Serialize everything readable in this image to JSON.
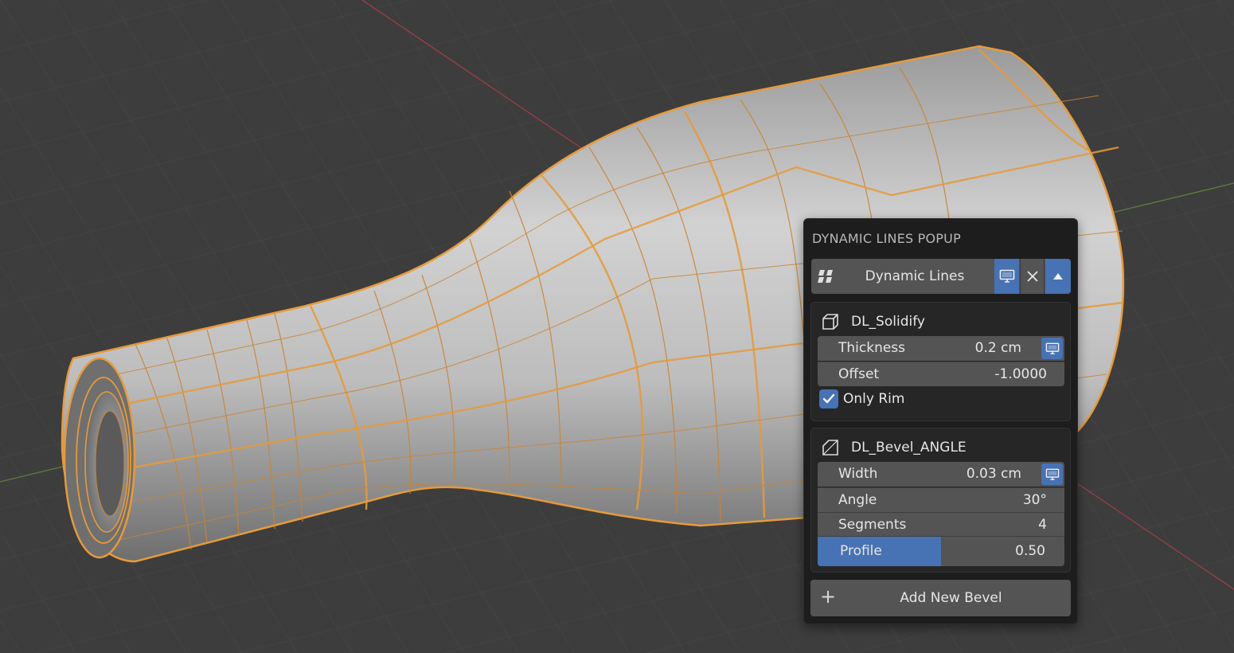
{
  "viewport": {
    "object_color": "#c9c9c9",
    "wire_color": "#e69a3c",
    "background_color": "#3d3d3d"
  },
  "popup": {
    "title": "DYNAMIC LINES POPUP",
    "header": {
      "label": "Dynamic Lines",
      "grip_icon": "grip-icon",
      "monitor_icon": "monitor-icon",
      "close_icon": "close-icon",
      "collapse_icon": "triangle-up-icon"
    },
    "solidify": {
      "name": "DL_Solidify",
      "icon": "solidify-cube-icon",
      "thickness_label": "Thickness",
      "thickness_value": "0.2 cm",
      "offset_label": "Offset",
      "offset_value": "-1.0000",
      "only_rim_label": "Only Rim",
      "only_rim_checked": true
    },
    "bevel": {
      "name": "DL_Bevel_ANGLE",
      "icon": "bevel-icon",
      "width_label": "Width",
      "width_value": "0.03 cm",
      "angle_label": "Angle",
      "angle_value": "30°",
      "segments_label": "Segments",
      "segments_value": "4",
      "profile_label": "Profile",
      "profile_value": "0.50",
      "profile_fraction": 0.5
    },
    "add_button": {
      "icon": "plus-icon",
      "label": "Add New Bevel"
    },
    "accent_color": "#4772b3"
  }
}
